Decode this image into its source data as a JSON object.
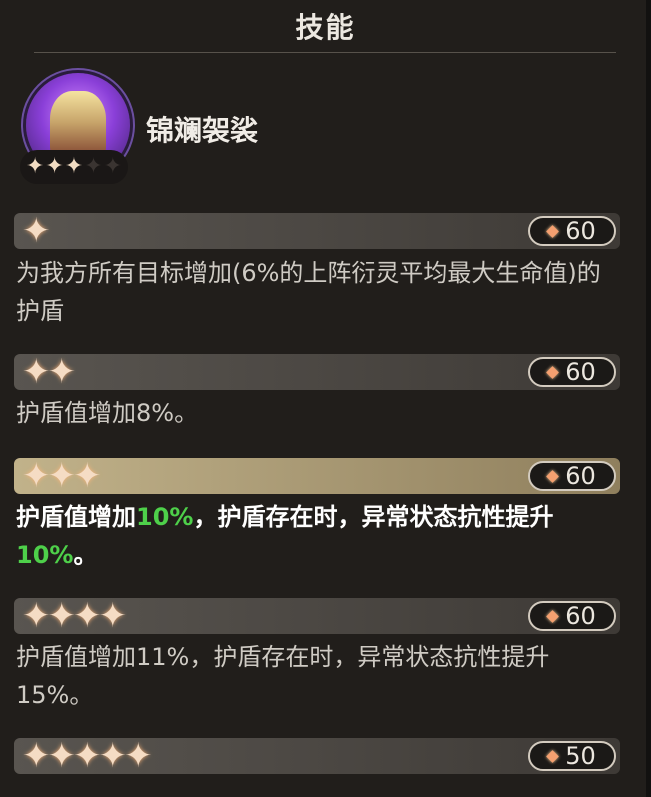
{
  "header": {
    "title": "技能"
  },
  "skill": {
    "name": "锦斓袈裟",
    "avatar_stars_lit": 3,
    "avatar_stars_total": 5
  },
  "tiers": [
    {
      "stars": 1,
      "cost": "60",
      "active": false,
      "desc_parts": [
        {
          "t": "为我方所有目标增加(6%的上阵衍灵平均最大生命值)的护盾",
          "hl": false
        }
      ]
    },
    {
      "stars": 2,
      "cost": "60",
      "active": false,
      "desc_parts": [
        {
          "t": "护盾值增加8%。",
          "hl": false
        }
      ]
    },
    {
      "stars": 3,
      "cost": "60",
      "active": true,
      "desc_parts": [
        {
          "t": "护盾值增加",
          "hl": false
        },
        {
          "t": "10%",
          "hl": true
        },
        {
          "t": "，护盾存在时，异常状态抗性提升",
          "hl": false
        },
        {
          "t": "10%",
          "hl": true
        },
        {
          "t": "。",
          "hl": false
        }
      ]
    },
    {
      "stars": 4,
      "cost": "60",
      "active": false,
      "desc_parts": [
        {
          "t": "护盾值增加11%，护盾存在时，异常状态抗性提升15%。",
          "hl": false
        }
      ]
    },
    {
      "stars": 5,
      "cost": "50",
      "active": false,
      "desc_parts": []
    }
  ],
  "colors": {
    "background": "#211e1b",
    "active_bar": "#c1b28a",
    "highlight": "#4ed04a",
    "star": "#f5dcc4",
    "gem": "#f5a070"
  }
}
